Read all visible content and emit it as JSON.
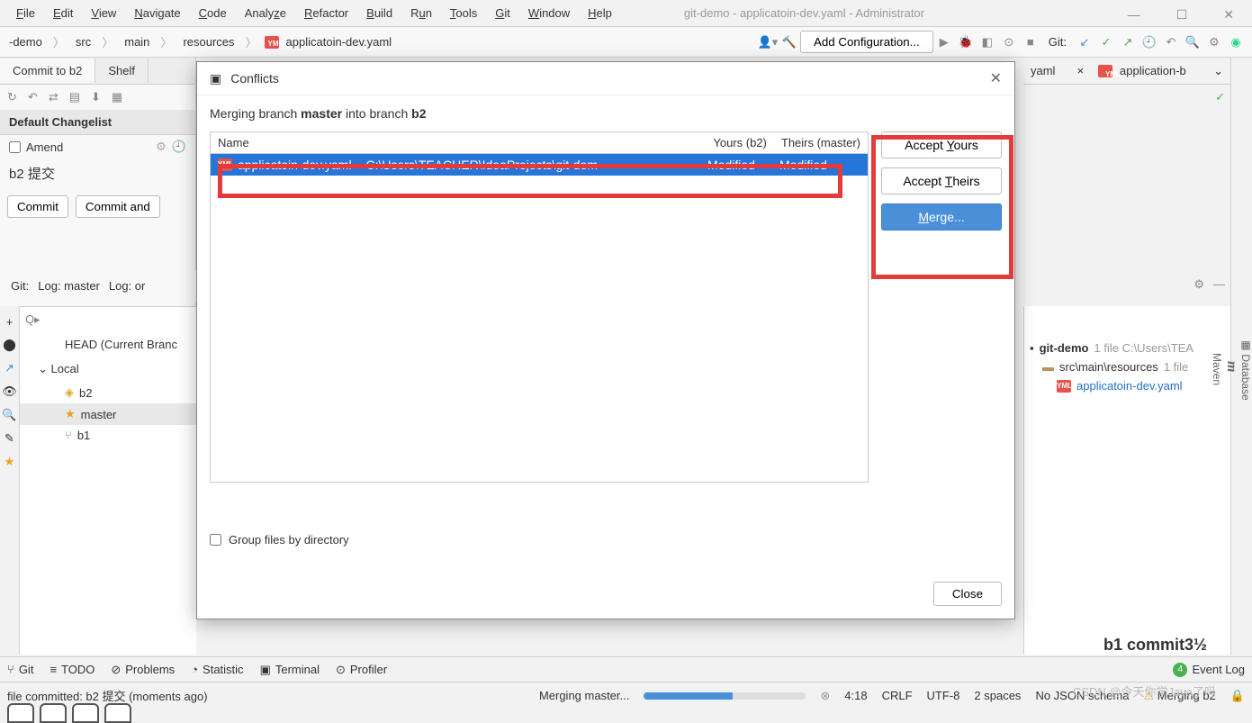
{
  "menu": {
    "file": "File",
    "edit": "Edit",
    "view": "View",
    "navigate": "Navigate",
    "code": "Code",
    "analyze": "Analyze",
    "refactor": "Refactor",
    "build": "Build",
    "run": "Run",
    "tools": "Tools",
    "git": "Git",
    "window": "Window",
    "help": "Help"
  },
  "window_title": "git-demo - applicatoin-dev.yaml - Administrator",
  "breadcrumb": {
    "p1": "-demo",
    "p2": "src",
    "p3": "main",
    "p4": "resources",
    "p5": "applicatoin-dev.yaml"
  },
  "toolbar": {
    "add_config": "Add Configuration...",
    "git_label": "Git:"
  },
  "left": {
    "commit_tab": "Commit to b2",
    "shelf_tab": "Shelf",
    "changelist": "Default Changelist",
    "amend": "Amend",
    "commit_btn": "Commit",
    "commit_and": "Commit and",
    "git": "Git:",
    "log_master": "Log: master",
    "log_or": "Log: or",
    "head": "HEAD (Current Branc",
    "local": "Local",
    "b2": "b2",
    "master": "master",
    "b1": "b1"
  },
  "right_tabs": {
    "yaml": "yaml",
    "app": "application-b"
  },
  "right_sidebar": {
    "database": "Database",
    "maven": "Maven"
  },
  "right_tree": {
    "repo": "git-demo",
    "repo_meta": "1 file  C:\\Users\\TEA",
    "folder": "src\\main\\resources",
    "folder_meta": "1 file",
    "file": "applicatoin-dev.yaml"
  },
  "dialog": {
    "title": "Conflicts",
    "merge_msg_pre": "Merging branch ",
    "merge_msg_b1": "master",
    "merge_msg_mid": " into branch ",
    "merge_msg_b2": "b2",
    "col_name": "Name",
    "col_yours": "Yours (b2)",
    "col_theirs": "Theirs (master)",
    "row_file": "applicatoin-dev.yaml",
    "row_path": "C:\\Users\\TEACHER\\IdeaProjects\\git-dem",
    "row_yours": "Modified",
    "row_theirs": "Modified",
    "accept_yours": "Accept Yours",
    "accept_theirs": "Accept Theirs",
    "merge": "Merge...",
    "group": "Group files by directory",
    "close": "Close"
  },
  "bottom_tabs": {
    "git": "Git",
    "todo": "TODO",
    "problems": "Problems",
    "statistic": "Statistic",
    "terminal": "Terminal",
    "profiler": "Profiler",
    "event_log": "Event Log",
    "event_count": "4"
  },
  "status": {
    "commit_msg": "file committed: b2 提交 (moments ago)",
    "merging": "Merging master...",
    "pos": "4:18",
    "crlf": "CRLF",
    "enc": "UTF-8",
    "spaces": "2 spaces",
    "schema": "No JSON schema",
    "merge_b2": "Merging b2"
  },
  "commit3": "b1  commit3½",
  "watermark": "CSDN @今天你学Java了吗"
}
